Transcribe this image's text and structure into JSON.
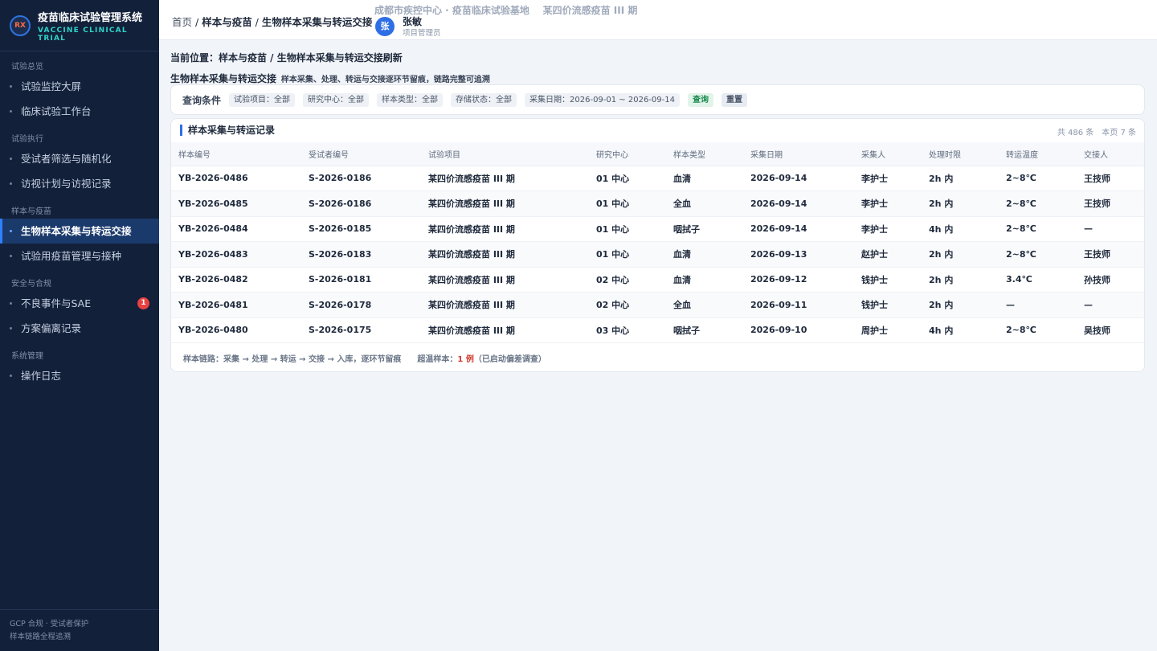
{
  "sidebar": {
    "brand_title": "疫苗临床试验管理系统",
    "brand_sub": "VACCINE CLINICAL TRIAL",
    "logo_text": "RX",
    "groups": [
      {
        "label": "试验总览",
        "items": [
          {
            "label": "试验监控大屏"
          },
          {
            "label": "临床试验工作台"
          }
        ]
      },
      {
        "label": "试验执行",
        "items": [
          {
            "label": "受试者筛选与随机化"
          },
          {
            "label": "访视计划与访视记录"
          }
        ]
      },
      {
        "label": "样本与疫苗",
        "items": [
          {
            "label": "生物样本采集与转运交接",
            "active": true
          },
          {
            "label": "试验用疫苗管理与接种"
          }
        ]
      },
      {
        "label": "安全与合规",
        "items": [
          {
            "label": "不良事件与SAE",
            "badge": "1"
          },
          {
            "label": "方案偏离记录"
          }
        ]
      },
      {
        "label": "系统管理",
        "items": [
          {
            "label": "操作日志"
          }
        ]
      }
    ],
    "footer_line1": "GCP 合规 · 受试者保护",
    "footer_line2": "样本链路全程追溯"
  },
  "header": {
    "crumb_home": "首页",
    "crumb_sep1": " / ",
    "crumb_section": "样本与疫苗",
    "crumb_sep2": " / ",
    "crumb_page": "生物样本采集与转运交接",
    "site": "成都市疾控中心 · 疫苗临床试验基地    某四价流感疫苗 III 期",
    "avatar_text": "张",
    "user_name": "张敏",
    "user_role": "项目管理员"
  },
  "main": {
    "location": "当前位置：样本与疫苗 / 生物样本采集与转运交接刷新",
    "title": "生物样本采集与转运交接",
    "subtitle": "样本采集、处理、转运与交接逐环节留痕，链路完整可追溯",
    "filter": {
      "label": "查询条件",
      "chips": [
        "试验项目：全部",
        "研究中心：全部",
        "样本类型：全部",
        "存储状态：全部",
        "采集日期：2026-09-01 ~ 2026-09-14"
      ],
      "query_label": "查询",
      "reset_label": "重置"
    },
    "table": {
      "title": "样本采集与转运记录",
      "total": "共 486 条",
      "page_count": "本页 7 条",
      "columns": [
        "样本编号",
        "受试者编号",
        "试验项目",
        "研究中心",
        "样本类型",
        "采集日期",
        "采集人",
        "处理时限",
        "转运温度",
        "交接人"
      ],
      "rows": [
        [
          "YB-2026-0486",
          "S-2026-0186",
          "某四价流感疫苗 III 期",
          "01 中心",
          "血清",
          "2026-09-14",
          "李护士",
          "2h 内",
          "2~8℃",
          "王技师"
        ],
        [
          "YB-2026-0485",
          "S-2026-0186",
          "某四价流感疫苗 III 期",
          "01 中心",
          "全血",
          "2026-09-14",
          "李护士",
          "2h 内",
          "2~8℃",
          "王技师"
        ],
        [
          "YB-2026-0484",
          "S-2026-0185",
          "某四价流感疫苗 III 期",
          "01 中心",
          "咽拭子",
          "2026-09-14",
          "李护士",
          "4h 内",
          "2~8℃",
          "—"
        ],
        [
          "YB-2026-0483",
          "S-2026-0183",
          "某四价流感疫苗 III 期",
          "01 中心",
          "血清",
          "2026-09-13",
          "赵护士",
          "2h 内",
          "2~8℃",
          "王技师"
        ],
        [
          "YB-2026-0482",
          "S-2026-0181",
          "某四价流感疫苗 III 期",
          "02 中心",
          "血清",
          "2026-09-12",
          "钱护士",
          "2h 内",
          "3.4℃",
          "孙技师"
        ],
        [
          "YB-2026-0481",
          "S-2026-0178",
          "某四价流感疫苗 III 期",
          "02 中心",
          "全血",
          "2026-09-11",
          "钱护士",
          "2h 内",
          "—",
          "—"
        ],
        [
          "YB-2026-0480",
          "S-2026-0175",
          "某四价流感疫苗 III 期",
          "03 中心",
          "咽拭子",
          "2026-09-10",
          "周护士",
          "4h 内",
          "2~8℃",
          "吴技师"
        ]
      ],
      "footer_chain": "样本链路：采集 → 处理 → 转运 → 交接 → 入库，逐环节留痕",
      "footer_temp_label": "超温样本：",
      "footer_temp_count": "1 例",
      "footer_temp_note": "（已启动偏差调查）"
    }
  }
}
